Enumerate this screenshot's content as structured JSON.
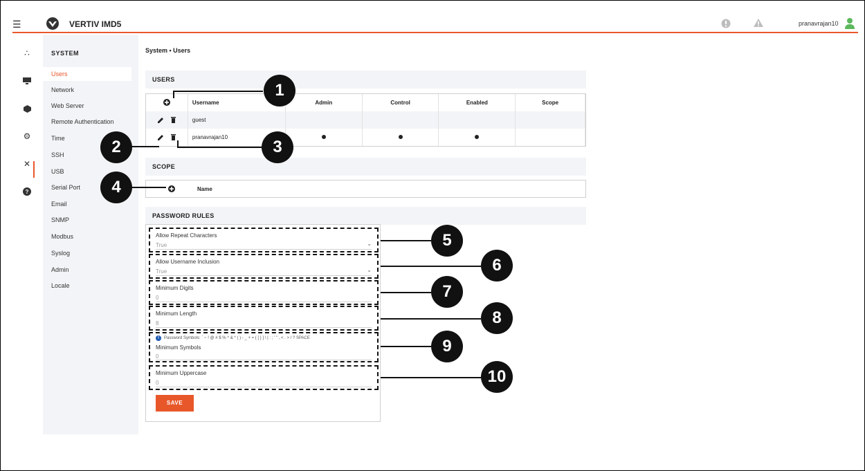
{
  "header": {
    "title": "VERTIV IMD5",
    "username": "pranavrajan10",
    "icons": [
      "menu-icon",
      "vertiv-logo",
      "alarm-icon",
      "warning-icon",
      "user-icon"
    ]
  },
  "rail": {
    "icons": [
      "network-icon",
      "monitor-icon",
      "box-icon",
      "gear-icon",
      "tools-icon",
      "help-icon"
    ]
  },
  "submenu": {
    "title": "SYSTEM",
    "items": [
      "Users",
      "Network",
      "Web Server",
      "Remote Authentication",
      "Time",
      "SSH",
      "USB",
      "Serial Port",
      "Email",
      "SNMP",
      "Modbus",
      "Syslog",
      "Admin",
      "Locale"
    ]
  },
  "breadcrumb": "System • Users",
  "users": {
    "section_title": "USERS",
    "columns": [
      "Username",
      "Admin",
      "Control",
      "Enabled",
      "Scope"
    ],
    "rows": [
      {
        "username": "guest",
        "admin": false,
        "control": false,
        "enabled": false
      },
      {
        "username": "pranavrajan10",
        "admin": true,
        "control": true,
        "enabled": true
      }
    ]
  },
  "scope": {
    "section_title": "SCOPE",
    "column": "Name"
  },
  "password_rules": {
    "section_title": "PASSWORD RULES",
    "fields": [
      {
        "label": "Allow Repeat Characters",
        "value": "True"
      },
      {
        "label": "Allow Username Inclusion",
        "value": "True"
      },
      {
        "label": "Minimum Digits",
        "value": "0"
      },
      {
        "label": "Minimum Length",
        "value": "8"
      },
      {
        "label": "Minimum Symbols",
        "value": "0",
        "hint": "Password Symbols: ` ~ ! @ # $ % ^ & * ( ) - _ + = { [ } ] \\ | : ; ' \" , < . > / ? SPACE"
      },
      {
        "label": "Minimum Uppercase",
        "value": "0"
      }
    ],
    "save_label": "SAVE"
  },
  "callouts": [
    "1",
    "2",
    "3",
    "4",
    "5",
    "6",
    "7",
    "8",
    "9",
    "10"
  ],
  "colors": {
    "accent": "#e8572a",
    "panel_bg": "#f3f4f7",
    "user_icon": "#5cb85c",
    "info": "#1f5bb5"
  }
}
